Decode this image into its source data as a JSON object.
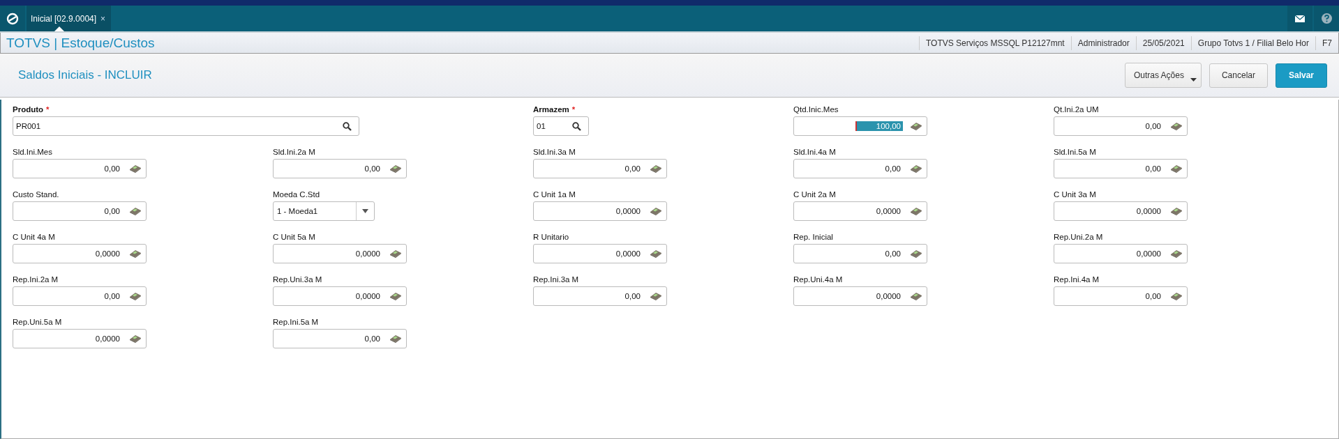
{
  "tabs": [
    {
      "label": "Inicial [02.9.0004]",
      "close": "×",
      "selected": true
    }
  ],
  "breadcrumb": "TOTVS | Estoque/Custos",
  "status_bar": [
    "TOTVS Serviços MSSQL P12127mnt",
    "Administrador",
    "25/05/2021",
    "Grupo Totvs 1 / Filial Belo Hor",
    "F7"
  ],
  "page_title": "Saldos Iniciais - INCLUIR",
  "buttons": [
    {
      "label": "Outras Ações",
      "kind": "menu"
    },
    {
      "label": "Cancelar",
      "kind": "secondary"
    },
    {
      "label": "Salvar",
      "kind": "primary"
    }
  ],
  "fields": [
    {
      "label": "Produto",
      "required_mark": "*",
      "kind": "lookup",
      "value": "PR001",
      "focused": false
    },
    {
      "label": "Armazem",
      "required_mark": "*",
      "kind": "lookup",
      "value": "01",
      "focused": false
    },
    {
      "label": "Qtd.Inic.Mes",
      "kind": "number",
      "value": "100,00",
      "focused": true
    },
    {
      "label": "Qt.Ini.2a UM",
      "kind": "number",
      "value": "0,00",
      "focused": false
    },
    {
      "label": "Sld.Ini.Mes",
      "kind": "number",
      "value": "0,00",
      "focused": false
    },
    {
      "label": "Sld.Ini.2a M",
      "kind": "number",
      "value": "0,00",
      "focused": false
    },
    {
      "label": "Sld.Ini.3a M",
      "kind": "number",
      "value": "0,00",
      "focused": false
    },
    {
      "label": "Sld.Ini.4a M",
      "kind": "number",
      "value": "0,00",
      "focused": false
    },
    {
      "label": "Sld.Ini.5a M",
      "kind": "number",
      "value": "0,00",
      "focused": false
    },
    {
      "label": "Custo Stand.",
      "kind": "number",
      "value": "0,00",
      "focused": false
    },
    {
      "label": "Moeda C.Std",
      "kind": "select",
      "value": "1 - Moeda1",
      "focused": false
    },
    {
      "label": "C Unit 1a M",
      "kind": "number",
      "value": "0,0000",
      "focused": false
    },
    {
      "label": "C Unit 2a M",
      "kind": "number",
      "value": "0,0000",
      "focused": false
    },
    {
      "label": "C Unit 3a M",
      "kind": "number",
      "value": "0,0000",
      "focused": false
    },
    {
      "label": "C Unit 4a M",
      "kind": "number",
      "value": "0,0000",
      "focused": false
    },
    {
      "label": "C Unit 5a M",
      "kind": "number",
      "value": "0,0000",
      "focused": false
    },
    {
      "label": "R Unitario",
      "kind": "number",
      "value": "0,0000",
      "focused": false
    },
    {
      "label": "Rep. Inicial",
      "kind": "number",
      "value": "0,00",
      "focused": false
    },
    {
      "label": "Rep.Uni.2a M",
      "kind": "number",
      "value": "0,0000",
      "focused": false
    },
    {
      "label": "Rep.Ini.2a M",
      "kind": "number",
      "value": "0,00",
      "focused": false
    },
    {
      "label": "Rep.Uni.3a M",
      "kind": "number",
      "value": "0,0000",
      "focused": false
    },
    {
      "label": "Rep.Ini.3a M",
      "kind": "number",
      "value": "0,00",
      "focused": false
    },
    {
      "label": "Rep.Uni.4a M",
      "kind": "number",
      "value": "0,0000",
      "focused": false
    },
    {
      "label": "Rep.Ini.4a M",
      "kind": "number",
      "value": "0,00",
      "focused": false
    },
    {
      "label": "Rep.Uni.5a M",
      "kind": "number",
      "value": "0,0000",
      "focused": false
    },
    {
      "label": "Rep.Ini.5a M",
      "kind": "number",
      "value": "0,00",
      "focused": false
    }
  ]
}
